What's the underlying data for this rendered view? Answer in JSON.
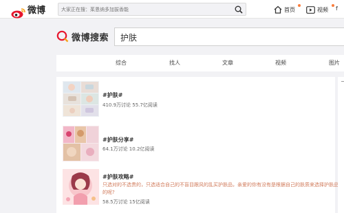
{
  "header": {
    "logo_text": "微博",
    "search_placeholder": "大家正在搜：茱恩纳多加拔香能",
    "nav": [
      {
        "label": "首页"
      },
      {
        "label": "视频"
      }
    ],
    "overflow": "f"
  },
  "search": {
    "brand": "微博搜索",
    "query": "护肤"
  },
  "tabs": [
    {
      "label": "综合"
    },
    {
      "label": "找人"
    },
    {
      "label": "文章"
    },
    {
      "label": "视频"
    },
    {
      "label": "图片"
    }
  ],
  "topics": [
    {
      "title": "#护肤#",
      "stats": "410.9万讨论 55.7亿阅读",
      "desc": ""
    },
    {
      "title": "#护肤分享#",
      "stats": "64.1万讨论 10.2亿阅读",
      "desc": ""
    },
    {
      "title": "#护肤攻略#",
      "stats": "58.5万讨论 15亿阅读",
      "desc": "只选对的不选贵的，只选适合自己的不盲目跟风的乱买护肤品，亲爱的你有没有是根据自己的肤质来选择护肤品的呢?"
    }
  ],
  "colors": {
    "accent": "#fa7d3c",
    "weibo_red": "#e6162d",
    "desc_text": "#d07a5a"
  },
  "icons": {
    "logo": "weibo-eye-icon",
    "search": "magnifier-icon",
    "home": "home-icon",
    "video": "video-icon",
    "brand": "weibo-search-q-icon"
  }
}
